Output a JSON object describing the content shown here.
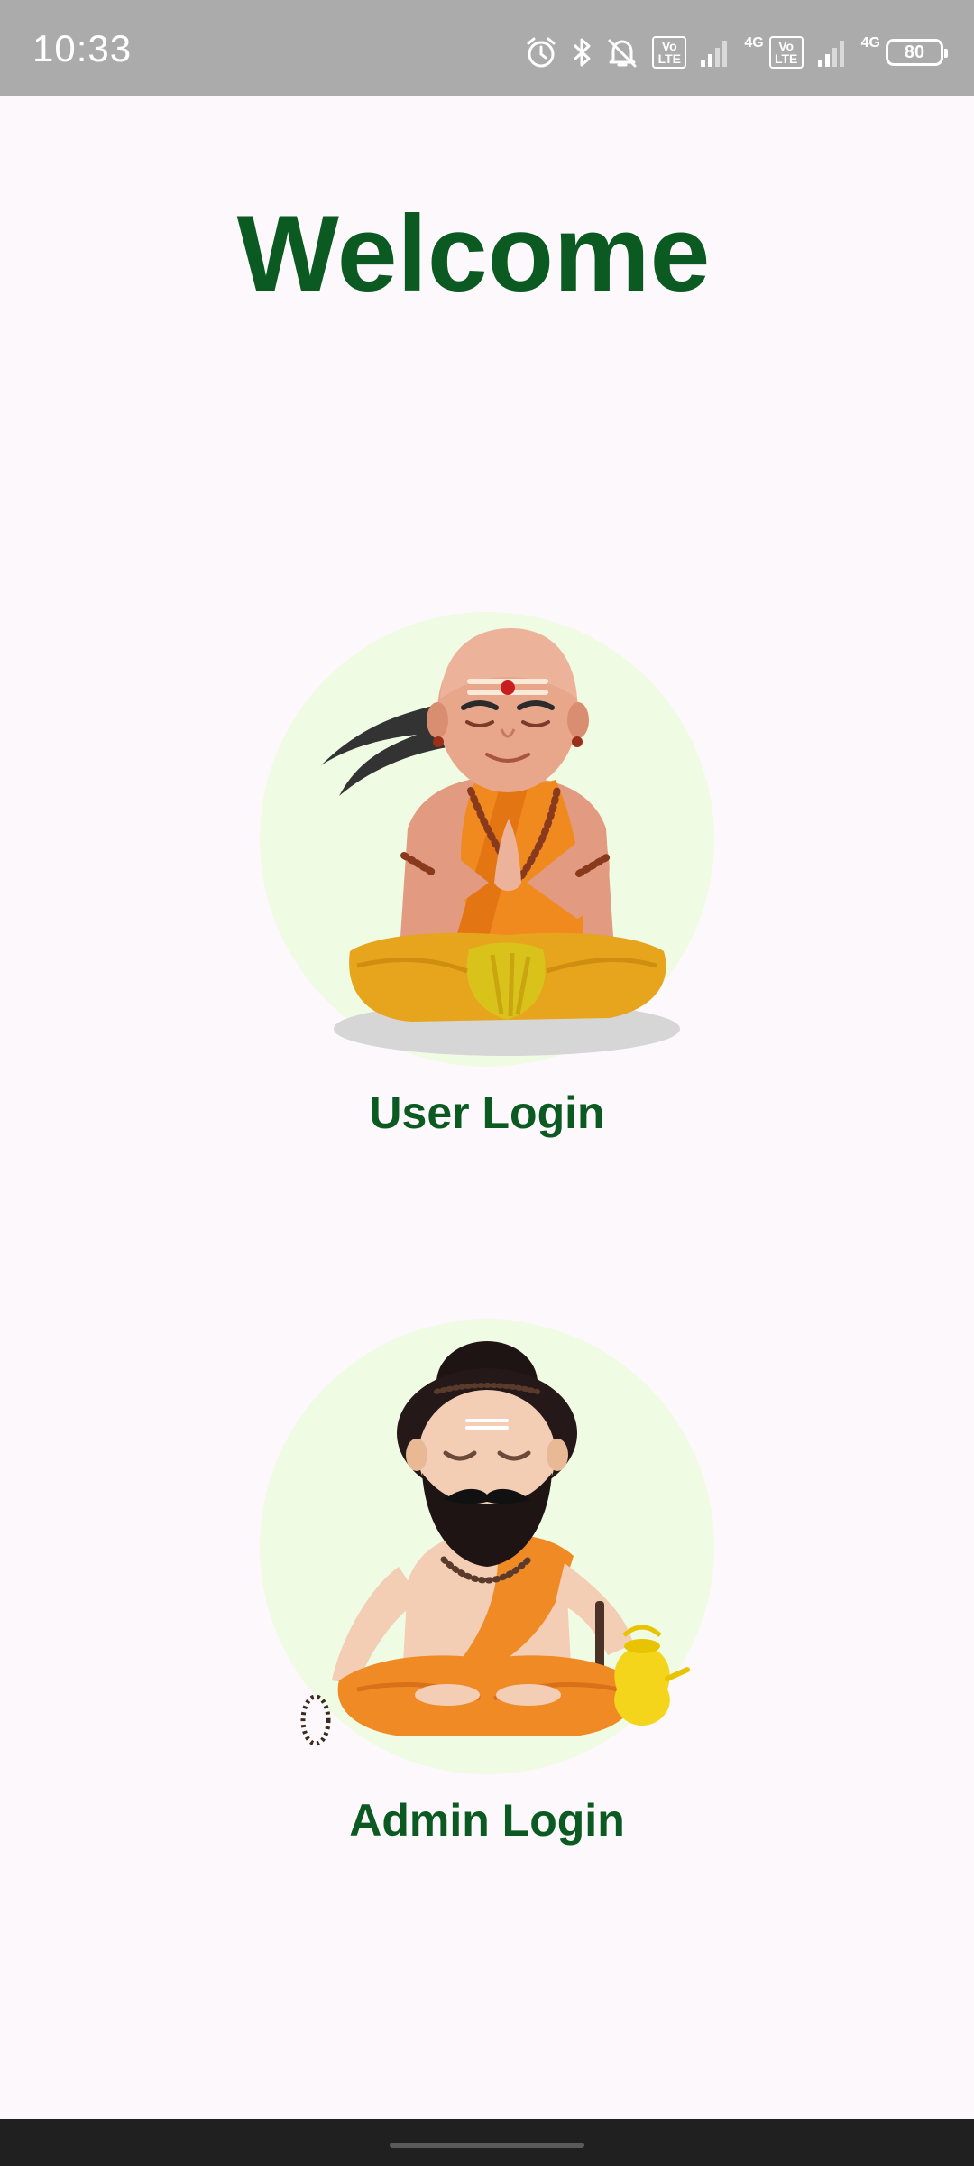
{
  "status_bar": {
    "time": "10:33",
    "icons": [
      "alarm-icon",
      "bluetooth-icon",
      "notification-muted-icon",
      "volte-icon",
      "signal-icon",
      "volte-icon",
      "signal-icon"
    ],
    "sim1_network": "4G",
    "sim2_network": "4G",
    "volte_label": "Vo LTE",
    "battery_level": "80"
  },
  "main": {
    "title": "Welcome",
    "user_login": {
      "label": "User Login",
      "illustration": "meditating-priest-illustration"
    },
    "admin_login": {
      "label": "Admin Login",
      "illustration": "meditating-sage-illustration"
    }
  },
  "colors": {
    "title_green": "#0B5A22",
    "background": "#FDF8FB",
    "circle": "#EFFBE3",
    "status_bar": "#ABABAB",
    "nav_bar": "#202020",
    "saffron": "#F08A24",
    "mustard": "#E6A51C"
  }
}
